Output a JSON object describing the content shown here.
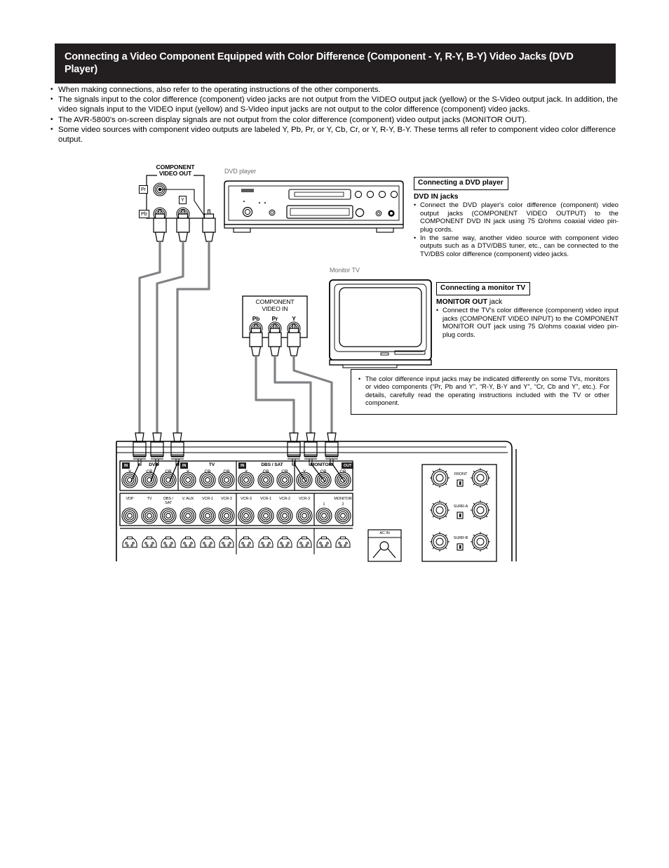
{
  "header": {
    "title": "Connecting a Video Component Equipped with Color Difference (Component - Y, R-Y, B-Y) Video Jacks (DVD Player)"
  },
  "intro": {
    "bullets": [
      "When making connections, also refer to the operating instructions of the other components.",
      "The signals input to the color difference (component) video jacks are not output from the VIDEO output jack (yellow) or the S-Video output jack. In addition, the video signals input to the VIDEO input (yellow) and S-Video input jacks are not output to the color difference (component) video jacks.",
      "The AVR-5800's on-screen display signals are not output from the color difference (component) video output jacks (MONITOR OUT).",
      "Some video sources with component video outputs are labeled Y, Pb, Pr, or Y, Cb, Cr, or Y, R-Y, B-Y. These terms all refer to component video color difference output."
    ]
  },
  "diagram": {
    "component_video_out": {
      "title_line1": "COMPONENT",
      "title_line2": "VIDEO OUT",
      "jack_pr": "Pr",
      "jack_pb": "Pb",
      "jack_y": "Y"
    },
    "dvd_player_caption": "DVD player",
    "monitor_tv_caption": "Monitor TV",
    "component_video_in": {
      "title_line1": "COMPONENT",
      "title_line2": "VIDEO IN",
      "jack_pb": "Pb",
      "jack_pr": "Pr",
      "jack_y": "Y"
    },
    "receiver_panel": {
      "component_row": {
        "groups": [
          {
            "badge": "IN",
            "name": "DVD",
            "jacks": [
              "Y",
              "CB",
              "CR"
            ]
          },
          {
            "badge": "IN",
            "name": "TV",
            "jacks": [
              "Y",
              "CB",
              "CR"
            ]
          },
          {
            "badge": "IN",
            "name": "DBS / SAT",
            "jacks": [
              "Y",
              "CB",
              "CR"
            ]
          },
          {
            "badge": "OUT",
            "name": "MONITOR",
            "jacks": [
              "Y",
              "CB",
              "CR"
            ]
          }
        ]
      },
      "video_row": {
        "labels": [
          "VDP",
          "TV",
          "DBS /\nSAT",
          "V. AUX",
          "VCR-1",
          "VCR-2",
          "VCR-3",
          "VCR-1",
          "VCR-2",
          "VCR-3"
        ],
        "monitor_label": "MONITOR",
        "monitor_jacks": [
          "1",
          "2"
        ]
      },
      "ac_in_label": "AC IN",
      "speaker_terminals": [
        "FRONT",
        "SURR-A",
        "SURR-B"
      ]
    }
  },
  "callouts": {
    "dvd": {
      "tag": "Connecting a DVD player",
      "heading": "DVD IN jacks",
      "bullets": [
        "Connect the DVD player's color difference (component) video output jacks (COMPONENT VIDEO OUTPUT) to the COMPONENT DVD IN jack using 75 Ω/ohms coaxial video pin-plug cords.",
        "In the same way, another video source with component video outputs such as a DTV/DBS tuner, etc., can be connected to the TV/DBS color difference (component) video jacks."
      ]
    },
    "monitor": {
      "tag": "Connecting a monitor TV",
      "heading_strong": "MONITOR OUT",
      "heading_rest": " jack",
      "bullets": [
        "Connect the TV's color difference (component) video input jacks (COMPONENT VIDEO INPUT) to the COMPONENT MONITOR OUT jack using 75 Ω/ohms coaxial video pin-plug cords."
      ]
    },
    "note": {
      "bullets": [
        "The color difference input jacks may be indicated differently on some TVs, monitors or video components (“Pr, Pb and Y”, “R-Y, B-Y and Y”, “Cr, Cb and Y”, etc.). For details, carefully read the operating instructions included with the TV or other component."
      ]
    }
  },
  "colors": {
    "header_bg": "#231f20",
    "cable": "#808285",
    "line": "#000000",
    "caption_grey": "#6d6e71"
  }
}
